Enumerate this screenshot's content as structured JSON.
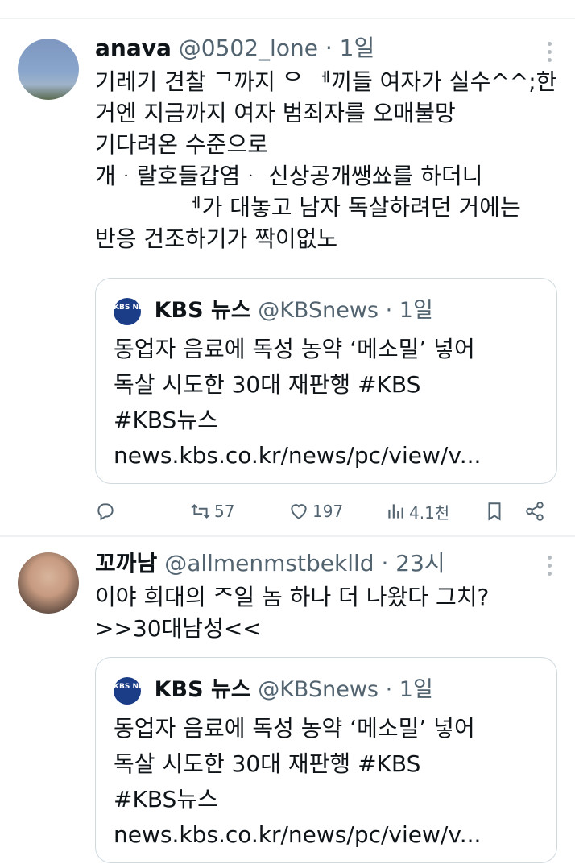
{
  "tweets": [
    {
      "display_name": "anava",
      "handle": "@0502_lone",
      "separator": "·",
      "time": "1일",
      "body_lines": [
        "기레기 견찰 ᄀ까지 ᄋ ᅦ끼들 여자가 실수^^;한",
        "거엔 지금까지 여자 범죄자를 오매불망",
        "기다려온 수준으로",
        "개ᆞ랄호들갑염ᆞ 신상공개쌩쑈를 하더니",
        "            ᅦ가 대놓고 남자 독살하려던 거에는",
        "반응 건조하기가 짝이없노"
      ],
      "quote": {
        "logo_text": "KBS NEWS",
        "display_name": "KBS 뉴스",
        "handle": "@KBSnews",
        "separator": "·",
        "time": "1일",
        "body_lines": [
          "동업자 음료에 독성 농약 ‘메소밀’ 넣어",
          "독살 시도한 30대 재판행 #KBS",
          "#KBS뉴스",
          "news.kbs.co.kr/news/pc/view/v..."
        ]
      },
      "actions": {
        "reply": {
          "icon": "reply-icon",
          "count": ""
        },
        "retweet": {
          "icon": "retweet-icon",
          "count": "57"
        },
        "like": {
          "icon": "heart-icon",
          "count": "197"
        },
        "views": {
          "icon": "views-icon",
          "count": "4.1천"
        },
        "bookmark": {
          "icon": "bookmark-icon"
        },
        "share": {
          "icon": "share-icon"
        }
      }
    },
    {
      "display_name": "꼬까남",
      "handle": "@allmenmstbeklld",
      "separator": "·",
      "time": "23시",
      "body_lines": [
        "이야 희대의 ᄌ일 놈 하나 더 나왔다 그치?",
        ">>30대남성<<"
      ],
      "quote": {
        "logo_text": "KBS NEWS",
        "display_name": "KBS 뉴스",
        "handle": "@KBSnews",
        "separator": "·",
        "time": "1일",
        "body_lines": [
          "동업자 음료에 독성 농약 ‘메소밀’ 넣어",
          "독살 시도한 30대 재판행 #KBS",
          "#KBS뉴스",
          "news.kbs.co.kr/news/pc/view/v..."
        ]
      }
    }
  ],
  "colors": {
    "text": "#0f1419",
    "secondary": "#536471",
    "border": "#cfd9de",
    "kbs_blue": "#1b3d87"
  }
}
